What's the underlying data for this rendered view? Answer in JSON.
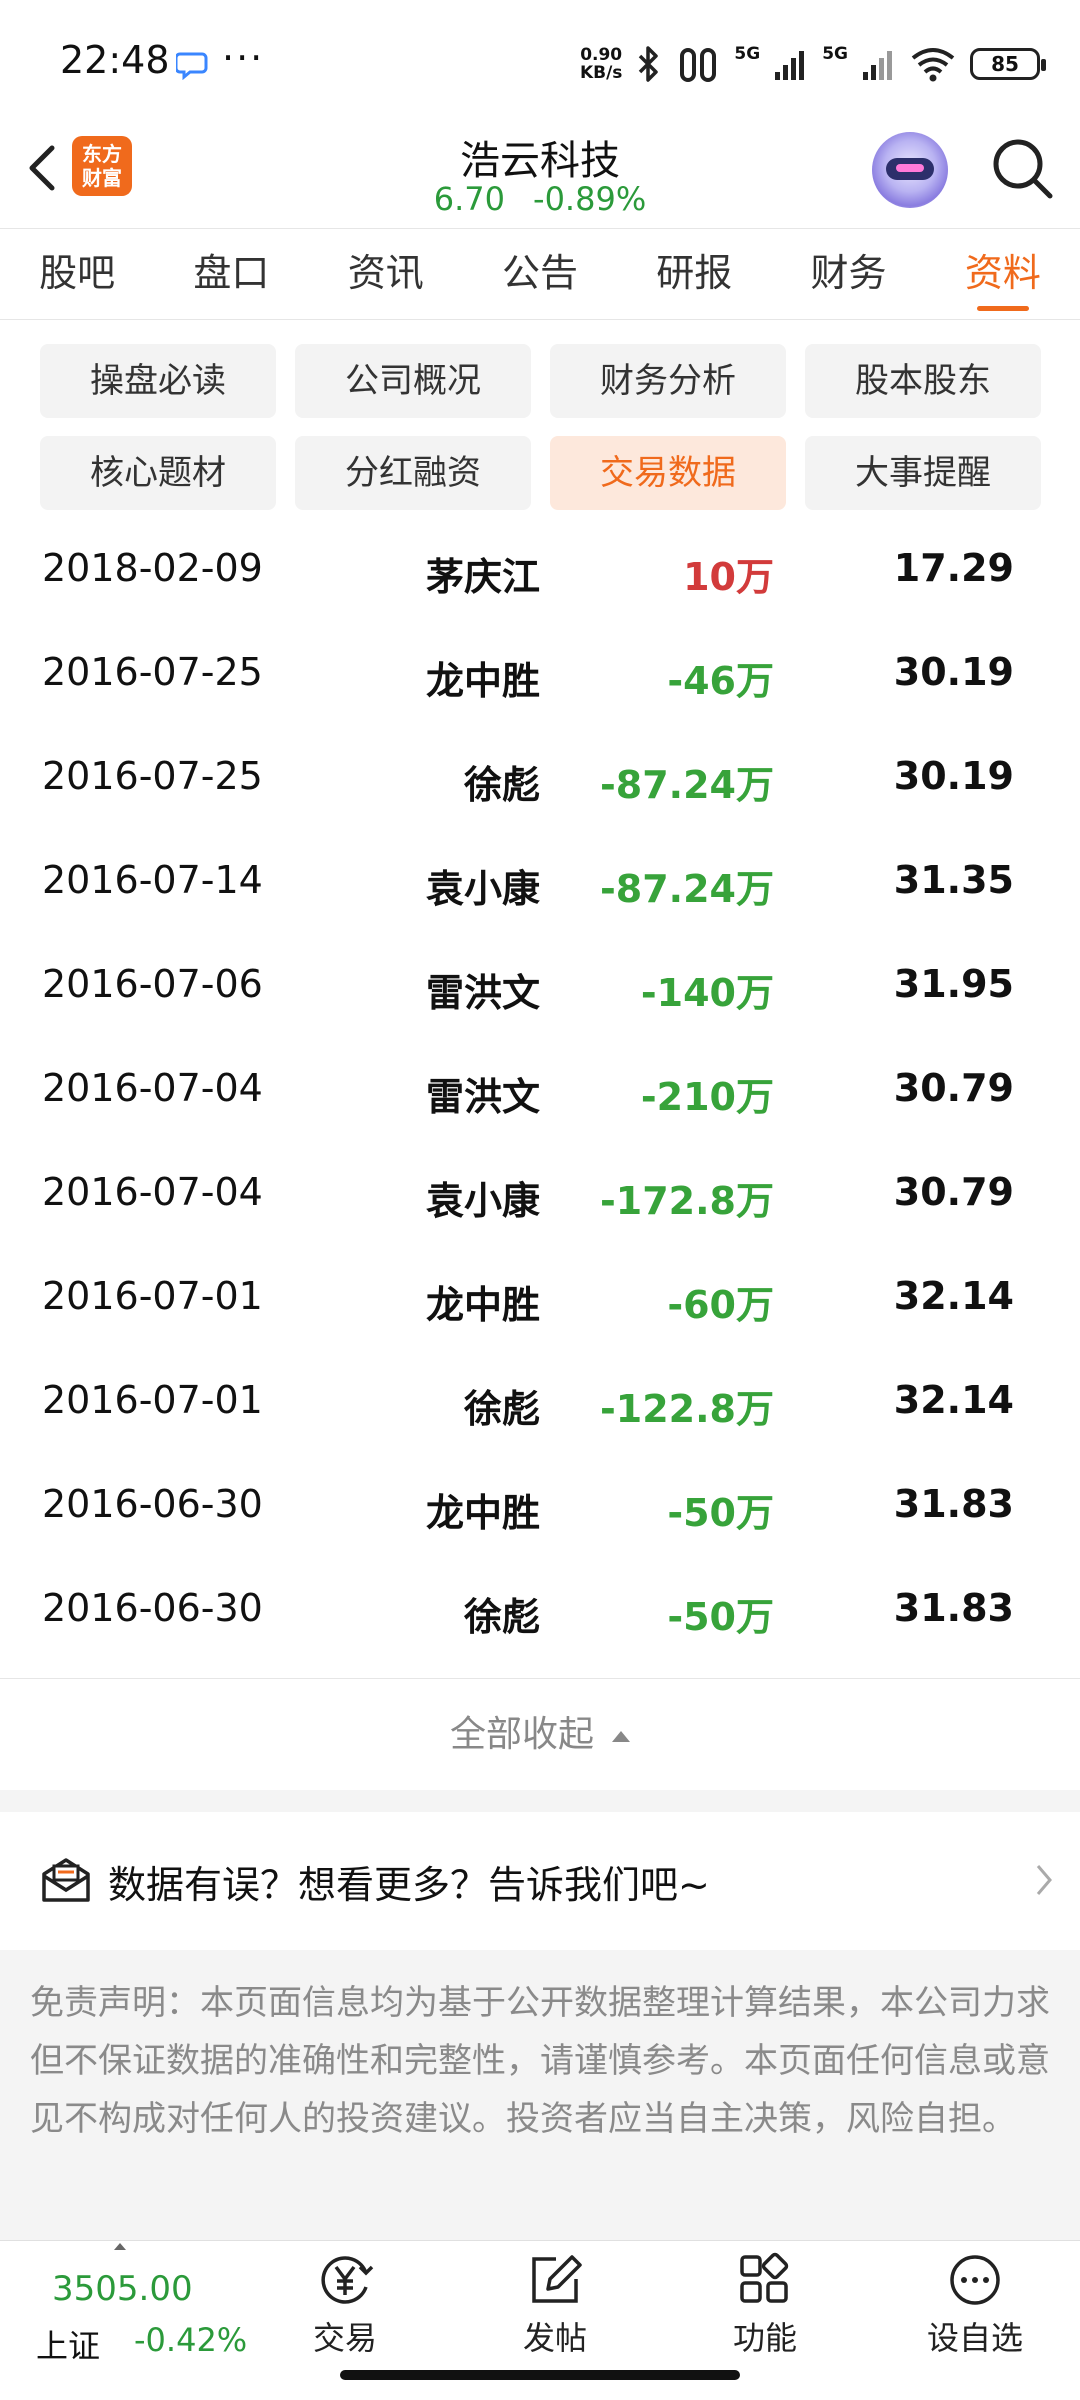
{
  "status_bar": {
    "time": "22:48",
    "more": "···",
    "net_speed_value": "0.90",
    "net_speed_unit": "KB/s",
    "signal_1": "5G",
    "signal_2": "5G",
    "battery": "85"
  },
  "header": {
    "logo_line1": "东方",
    "logo_line2": "财富",
    "stock_name": "浩云科技",
    "price": "6.70",
    "change_pct": "-0.89%"
  },
  "tabs": [
    {
      "label": "股吧"
    },
    {
      "label": "盘口"
    },
    {
      "label": "资讯"
    },
    {
      "label": "公告"
    },
    {
      "label": "研报"
    },
    {
      "label": "财务"
    },
    {
      "label": "资料",
      "active": true
    }
  ],
  "chips": [
    {
      "label": "操盘必读"
    },
    {
      "label": "公司概况"
    },
    {
      "label": "财务分析"
    },
    {
      "label": "股本股东"
    },
    {
      "label": "核心题材"
    },
    {
      "label": "分红融资"
    },
    {
      "label": "交易数据",
      "active": true
    },
    {
      "label": "大事提醒"
    }
  ],
  "rows": [
    {
      "date": "2018-02-09",
      "name": "茅庆江",
      "amount": "10万",
      "price": "17.29",
      "sign": "pos"
    },
    {
      "date": "2016-07-25",
      "name": "龙中胜",
      "amount": "-46万",
      "price": "30.19",
      "sign": "neg"
    },
    {
      "date": "2016-07-25",
      "name": "徐彪",
      "amount": "-87.24万",
      "price": "30.19",
      "sign": "neg"
    },
    {
      "date": "2016-07-14",
      "name": "袁小康",
      "amount": "-87.24万",
      "price": "31.35",
      "sign": "neg"
    },
    {
      "date": "2016-07-06",
      "name": "雷洪文",
      "amount": "-140万",
      "price": "31.95",
      "sign": "neg"
    },
    {
      "date": "2016-07-04",
      "name": "雷洪文",
      "amount": "-210万",
      "price": "30.79",
      "sign": "neg"
    },
    {
      "date": "2016-07-04",
      "name": "袁小康",
      "amount": "-172.8万",
      "price": "30.79",
      "sign": "neg"
    },
    {
      "date": "2016-07-01",
      "name": "龙中胜",
      "amount": "-60万",
      "price": "32.14",
      "sign": "neg"
    },
    {
      "date": "2016-07-01",
      "name": "徐彪",
      "amount": "-122.8万",
      "price": "32.14",
      "sign": "neg"
    },
    {
      "date": "2016-06-30",
      "name": "龙中胜",
      "amount": "-50万",
      "price": "31.83",
      "sign": "neg"
    },
    {
      "date": "2016-06-30",
      "name": "徐彪",
      "amount": "-50万",
      "price": "31.83",
      "sign": "neg"
    }
  ],
  "collapse_label": "全部收起",
  "feedback_label": "数据有误？想看更多？告诉我们吧~",
  "disclaimer": "免责声明：本页面信息均为基于公开数据整理计算结果，本公司力求但不保证数据的准确性和完整性，请谨慎参考。本页面任何信息或意见不构成对任何人的投资建议。投资者应当自主决策，风险自担。",
  "bottom_bar": {
    "index_value": "3505.00",
    "index_name": "上证",
    "index_change": "-0.42%",
    "items": [
      {
        "label": "交易",
        "icon": "trade-yen-icon"
      },
      {
        "label": "发帖",
        "icon": "edit-post-icon"
      },
      {
        "label": "功能",
        "icon": "grid-functions-icon"
      },
      {
        "label": "设自选",
        "icon": "more-dots-icon"
      }
    ]
  },
  "colors": {
    "accent": "#f06a1c",
    "up": "#d23b3b",
    "down": "#37a33a"
  }
}
